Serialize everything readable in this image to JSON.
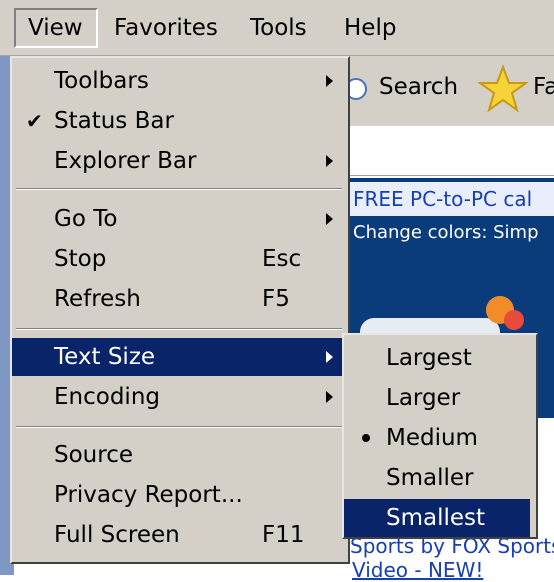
{
  "menubar": {
    "items": [
      {
        "label": "View",
        "open": true
      },
      {
        "label": "Favorites"
      },
      {
        "label": "Tools"
      },
      {
        "label": "Help"
      }
    ]
  },
  "background": {
    "toolbar_search_label": "Search",
    "toolbar_favorites_label": "Fa",
    "banner_link": "FREE PC-to-PC cal",
    "colors_text": "Change colors:  Simp",
    "sports_text": "Sports by FOX Sports",
    "video_link": "Video - NEW!"
  },
  "view_menu": {
    "toolbars": "Toolbars",
    "status_bar": "Status Bar",
    "status_bar_checked": true,
    "explorer_bar": "Explorer Bar",
    "go_to": "Go To",
    "stop": "Stop",
    "stop_shortcut": "Esc",
    "refresh": "Refresh",
    "refresh_shortcut": "F5",
    "text_size": "Text Size",
    "encoding": "Encoding",
    "source": "Source",
    "privacy_report": "Privacy Report...",
    "full_screen": "Full Screen",
    "full_screen_shortcut": "F11"
  },
  "text_size_menu": {
    "largest": "Largest",
    "larger": "Larger",
    "medium": "Medium",
    "smaller": "Smaller",
    "smallest": "Smallest",
    "selected": "Medium",
    "hovered": "Smallest"
  },
  "colors": {
    "menu_bg": "#d4d0c8",
    "highlight": "#0a246a",
    "link": "#1640b3",
    "page_blue": "#0a3b7a"
  },
  "icons": [
    "check-icon",
    "submenu-arrow-icon",
    "radio-bullet-icon",
    "star-icon",
    "search-icon"
  ]
}
